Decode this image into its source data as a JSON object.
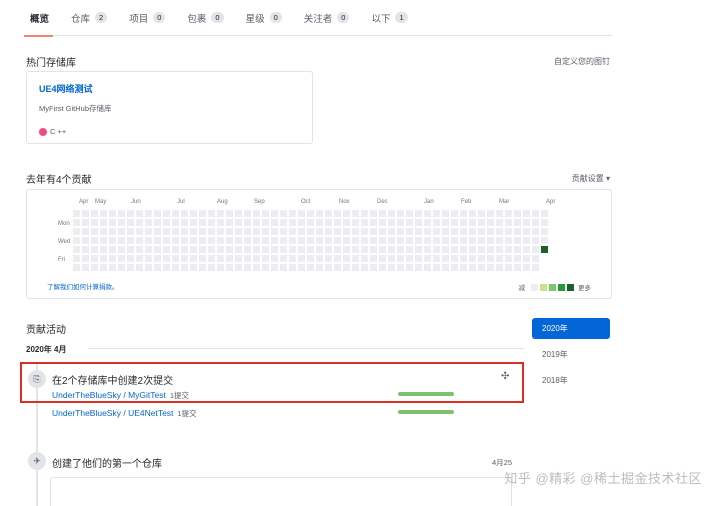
{
  "tabs": [
    {
      "label": "概览",
      "count": null,
      "active": true
    },
    {
      "label": "仓库",
      "count": "2"
    },
    {
      "label": "项目",
      "count": "0"
    },
    {
      "label": "包裹",
      "count": "0"
    },
    {
      "label": "星级",
      "count": "0"
    },
    {
      "label": "关注者",
      "count": "0"
    },
    {
      "label": "以下",
      "count": "1"
    }
  ],
  "pinned": {
    "title": "热门存储库",
    "customize_link": "自定义您的图钉",
    "repo": {
      "name": "UE4网络测试",
      "description": "MyFirst GitHub存储库",
      "language": "C ++",
      "language_color": "#f34b7d"
    }
  },
  "contributions": {
    "title": "去年有4个贡献",
    "settings_label": "贡献设置",
    "months": [
      "Apr",
      "May",
      "Jun",
      "Jul",
      "Aug",
      "Sep",
      "Oct",
      "Nov",
      "Dec",
      "Jan",
      "Feb",
      "Mar",
      "Apr"
    ],
    "days": [
      "Mon",
      "Wed",
      "Fri"
    ],
    "learn_link": "了解我们如何计算捐款。",
    "legend_less": "减",
    "legend_more": "更多",
    "colors": [
      "#ebedf0",
      "#c6e48b",
      "#7bc96f",
      "#239a3b",
      "#196127"
    ]
  },
  "activity": {
    "title": "贡献活动",
    "month_label": "2020年 4月",
    "commits_title": "在2个存储库中创建2次提交",
    "repos": [
      {
        "name": "UnderTheBlueSky / MyGitTest",
        "count": "1提交",
        "fraction": 1.0
      },
      {
        "name": "UnderTheBlueSky / UE4NetTest",
        "count": "1提交",
        "fraction": 1.0
      }
    ],
    "created_title": "创建了他们的第一个仓库",
    "created_date": "4月25"
  },
  "years": [
    {
      "label": "2020年",
      "active": true
    },
    {
      "label": "2019年"
    },
    {
      "label": "2018年"
    }
  ],
  "watermark": "知乎 @精彩 @稀土掘金技术社区"
}
